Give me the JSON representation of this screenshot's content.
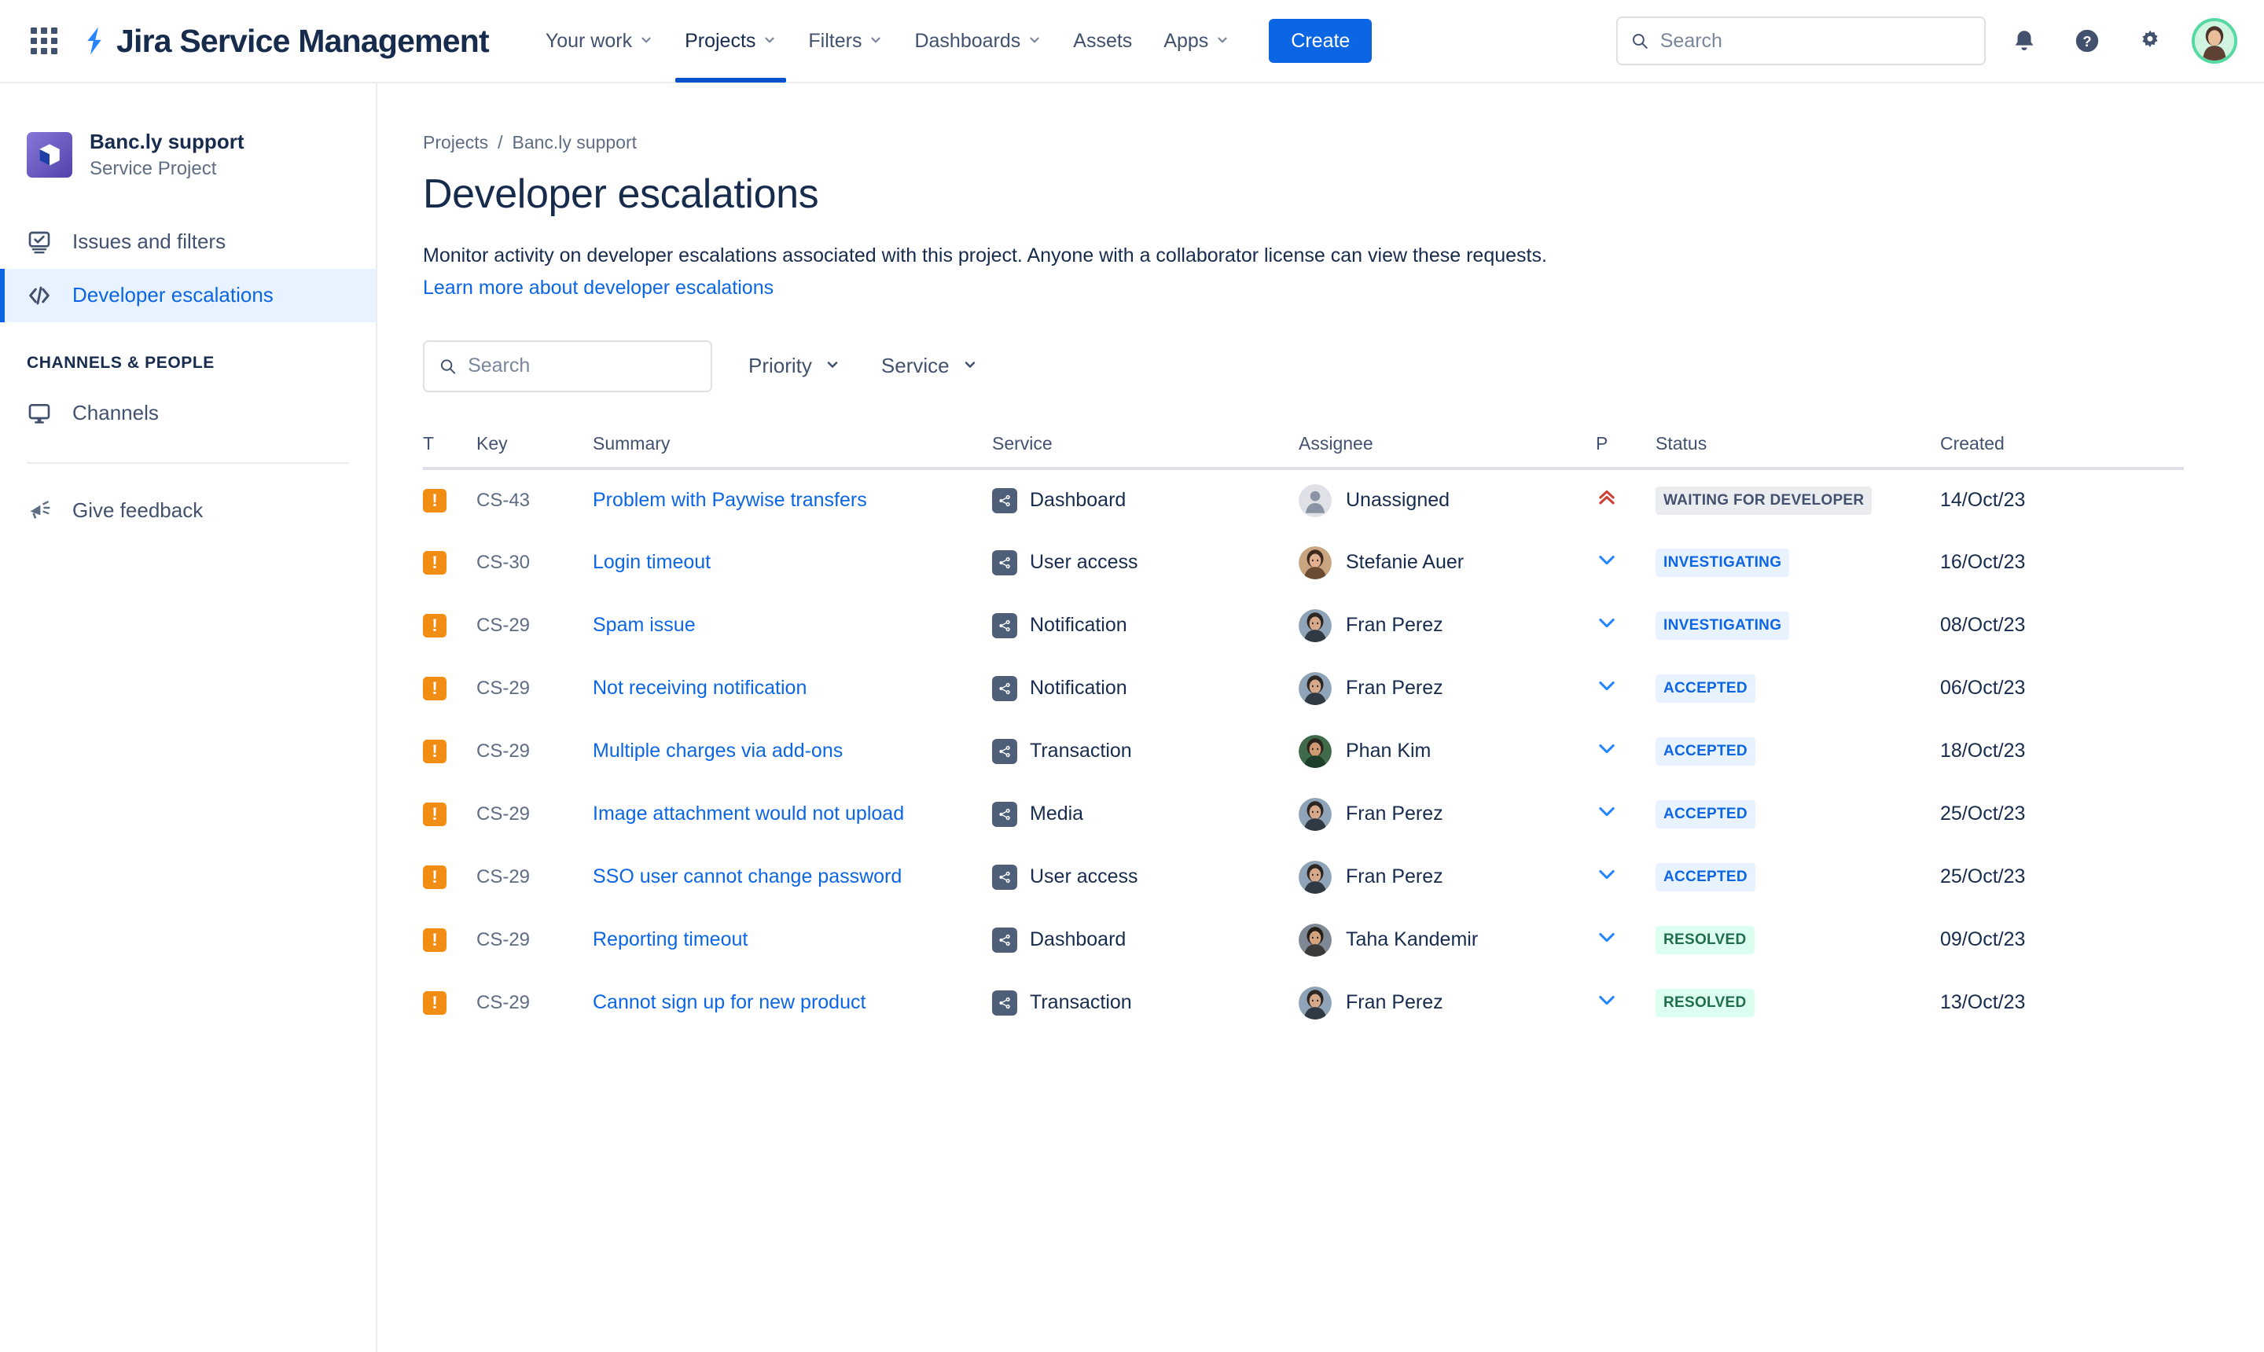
{
  "topnav": {
    "app_switcher": "apps-grid-icon",
    "brand": "Jira Service Management",
    "items": [
      {
        "label": "Your work",
        "has_caret": true,
        "selected": false
      },
      {
        "label": "Projects",
        "has_caret": true,
        "selected": true
      },
      {
        "label": "Filters",
        "has_caret": true,
        "selected": false
      },
      {
        "label": "Dashboards",
        "has_caret": true,
        "selected": false
      },
      {
        "label": "Assets",
        "has_caret": false,
        "selected": false
      },
      {
        "label": "Apps",
        "has_caret": true,
        "selected": false
      }
    ],
    "create_label": "Create",
    "search_placeholder": "Search",
    "search_value": "",
    "icons": [
      "notifications-icon",
      "help-icon",
      "settings-gear-icon",
      "profile-avatar"
    ]
  },
  "sidebar": {
    "project_name": "Banc.ly support",
    "project_type": "Service Project",
    "items": [
      {
        "label": "Issues and filters",
        "icon": "issues-monitor-icon",
        "active": false
      },
      {
        "label": "Developer escalations",
        "icon": "code-brackets-icon",
        "active": true
      }
    ],
    "section_title": "CHANNELS & PEOPLE",
    "channels": [
      {
        "label": "Channels",
        "icon": "monitor-icon",
        "active": false
      }
    ],
    "feedback": {
      "label": "Give feedback",
      "icon": "megaphone-icon"
    }
  },
  "main": {
    "breadcrumb": [
      "Projects",
      "Banc.ly support"
    ],
    "breadcrumb_separator": "/",
    "title": "Developer escalations",
    "description": "Monitor activity on developer escalations associated with this project. Anyone with a collaborator license can view these requests.",
    "link": "Learn more about developer escalations",
    "filters": {
      "search_placeholder": "Search",
      "search_value": "",
      "priority_label": "Priority",
      "service_label": "Service"
    },
    "table": {
      "columns": [
        "T",
        "Key",
        "Summary",
        "Service",
        "Assignee",
        "P",
        "Status",
        "Created"
      ],
      "rows": [
        {
          "type": "escalation",
          "key": "CS-43",
          "summary": "Problem with Paywise transfers",
          "service": "Dashboard",
          "assignee": "Unassigned",
          "avatar": "unassigned",
          "priority": "highest",
          "status": "WAITING FOR DEVELOPER",
          "status_tone": "gray",
          "created": "14/Oct/23"
        },
        {
          "type": "escalation",
          "key": "CS-30",
          "summary": "Login timeout",
          "service": "User access",
          "assignee": "Stefanie Auer",
          "avatar": "f1",
          "priority": "low",
          "status": "INVESTIGATING",
          "status_tone": "blue",
          "created": "16/Oct/23"
        },
        {
          "type": "escalation",
          "key": "CS-29",
          "summary": "Spam issue",
          "service": "Notification",
          "assignee": "Fran Perez",
          "avatar": "f2",
          "priority": "low",
          "status": "INVESTIGATING",
          "status_tone": "blue",
          "created": "08/Oct/23"
        },
        {
          "type": "escalation",
          "key": "CS-29",
          "summary": "Not receiving notification",
          "service": "Notification",
          "assignee": "Fran Perez",
          "avatar": "f2",
          "priority": "low",
          "status": "ACCEPTED",
          "status_tone": "blue",
          "created": "06/Oct/23"
        },
        {
          "type": "escalation",
          "key": "CS-29",
          "summary": "Multiple charges via add-ons",
          "service": "Transaction",
          "assignee": "Phan Kim",
          "avatar": "m1",
          "priority": "low",
          "status": "ACCEPTED",
          "status_tone": "blue",
          "created": "18/Oct/23"
        },
        {
          "type": "escalation",
          "key": "CS-29",
          "summary": "Image attachment would not upload",
          "service": "Media",
          "assignee": "Fran Perez",
          "avatar": "f2",
          "priority": "low",
          "status": "ACCEPTED",
          "status_tone": "blue",
          "created": "25/Oct/23"
        },
        {
          "type": "escalation",
          "key": "CS-29",
          "summary": "SSO user cannot change password",
          "service": "User access",
          "assignee": "Fran Perez",
          "avatar": "f2",
          "priority": "low",
          "status": "ACCEPTED",
          "status_tone": "blue",
          "created": "25/Oct/23"
        },
        {
          "type": "escalation",
          "key": "CS-29",
          "summary": "Reporting timeout",
          "service": "Dashboard",
          "assignee": "Taha Kandemir",
          "avatar": "m2",
          "priority": "low",
          "status": "RESOLVED",
          "status_tone": "green",
          "created": "09/Oct/23"
        },
        {
          "type": "escalation",
          "key": "CS-29",
          "summary": "Cannot sign up for new product",
          "service": "Transaction",
          "assignee": "Fran Perez",
          "avatar": "f2",
          "priority": "low",
          "status": "RESOLVED",
          "status_tone": "green",
          "created": "13/Oct/23"
        }
      ]
    }
  },
  "colors": {
    "accent": "#0C66E4",
    "nav_underline": "#0052CC",
    "type_icon": "#F18D13",
    "service_icon": "#505F79",
    "priority_high": "#CD3F32",
    "priority_low": "#2684FF",
    "status_gray_bg": "#EBECF0",
    "status_blue_bg": "#E9F2FF",
    "status_green_bg": "#DCFFF1",
    "sidebar_active_bg": "#E9F2FF",
    "avatar_ring": "#57D9A3"
  }
}
